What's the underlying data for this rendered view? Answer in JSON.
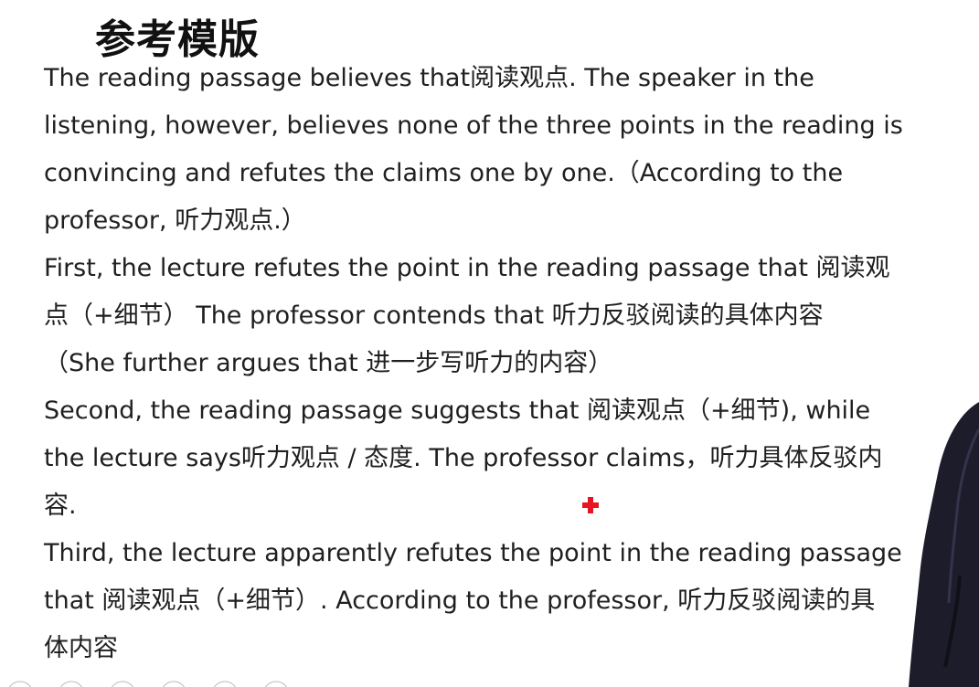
{
  "slide": {
    "title": "参考模版",
    "lines": [
      "The reading passage believes that阅读观点. The speaker in the",
      "listening, however, believes none of the three points in the reading is",
      "convincing and refutes the claims one by one.（According to the",
      "professor, 听力观点.）",
      "First, the lecture refutes the point in the reading passage that 阅读观",
      "点（+细节） The professor contends that 听力反驳阅读的具体内容",
      "（She further argues that 进一步写听力的内容）",
      "Second, the reading passage suggests that 阅读观点（+细节), while",
      "the lecture says听力观点 / 态度. The professor claims，听力具体反驳内",
      "容.",
      "Third, the lecture apparently refutes the point in the reading passage",
      "that 阅读观点（+细节）. According to the professor, 听力反驳阅读的具",
      "体内容"
    ]
  },
  "colors": {
    "background": "#ffffff",
    "text": "#202020",
    "pointer": "#e8141f",
    "presenter_suit": "#1d1c2a"
  }
}
